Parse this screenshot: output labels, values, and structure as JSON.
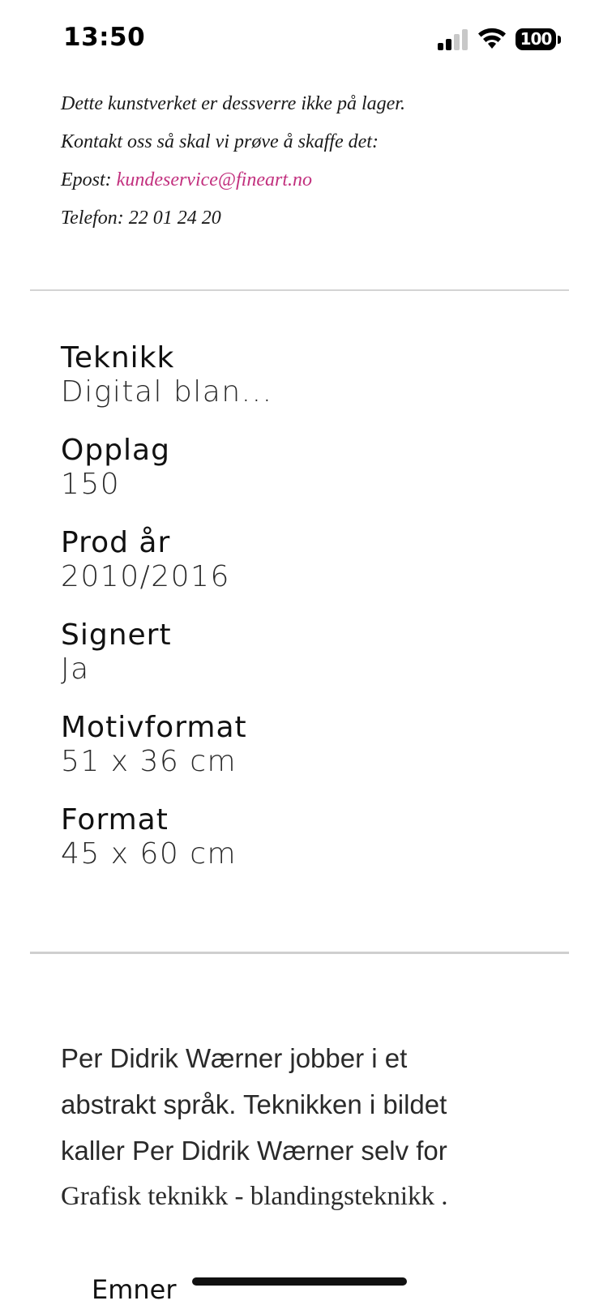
{
  "status_bar": {
    "time": "13:50",
    "battery": "100",
    "icons": [
      "signal-icon",
      "wifi-icon",
      "battery-icon"
    ]
  },
  "notice": {
    "line1": "Dette kunstverket er dessverre ikke på lager.",
    "line2": "Kontakt oss så skal vi prøve å skaffe det:",
    "email_label": "Epost: ",
    "email": "kundeservice@fineart.no",
    "phone": "Telefon: 22 01 24 20"
  },
  "specs": [
    {
      "label": "Teknikk",
      "value": "Digital blan..."
    },
    {
      "label": "Opplag",
      "value": "150"
    },
    {
      "label": "Prod år",
      "value": "2010/2016"
    },
    {
      "label": "Signert",
      "value": "Ja"
    },
    {
      "label": "Motivformat",
      "value": "51 x 36 cm"
    },
    {
      "label": "Format",
      "value": "45 x 60 cm"
    }
  ],
  "description": {
    "line1": "Per Didrik Wærner jobber i et",
    "line2": "abstrakt språk. Teknikken i bildet",
    "line3": "kaller Per Didrik Wærner selv for",
    "line4": "Grafisk teknikk - blandingsteknikk ."
  },
  "subjects_heading": "Emner",
  "colors": {
    "link": "#c2307e",
    "divider": "#d4d4d4",
    "text": "#111111"
  }
}
